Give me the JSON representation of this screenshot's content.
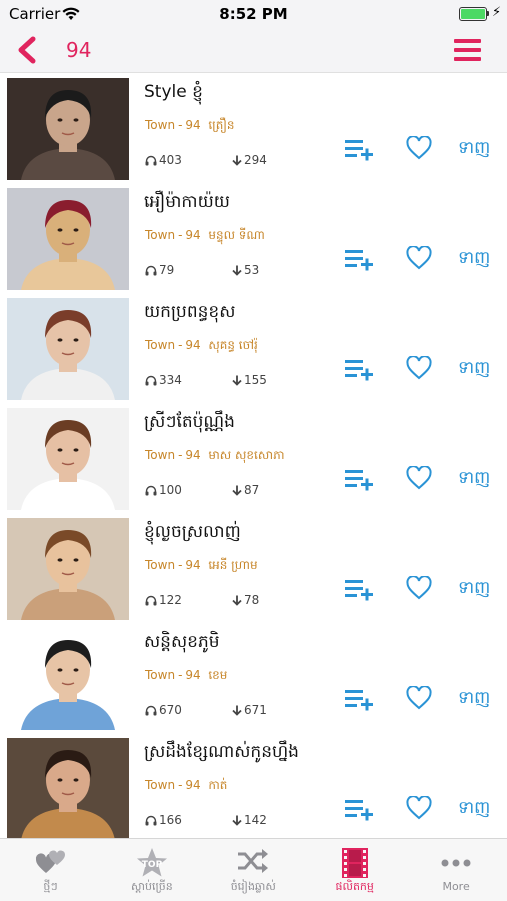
{
  "status_bar": {
    "carrier": "Carrier",
    "time": "8:52 PM",
    "battery_level": 1.0
  },
  "nav": {
    "title": "94",
    "back_icon": "chevron-left-icon",
    "menu_icon": "hamburger-menu-icon",
    "accent": "#e0245e"
  },
  "songs": [
    {
      "title": "Style ខ្ញុំ",
      "album": "Town",
      "number": "94",
      "artist": "ត្រឿន",
      "listens": "403",
      "downloads": "294",
      "get_label": "ទាញ"
    },
    {
      "title": "អឿម៉ាកាយ៉យ",
      "album": "Town",
      "number": "94",
      "artist": "មន្ទុល ទីណា",
      "listens": "79",
      "downloads": "53",
      "get_label": "ទាញ"
    },
    {
      "title": "យកប្រពន្ធខុស",
      "album": "Town",
      "number": "94",
      "artist": "សុគន្ធ ចៅរ៉ុ",
      "listens": "334",
      "downloads": "155",
      "get_label": "ទាញ"
    },
    {
      "title": "ស្រីៗតែប៉ុណ្ណឹង",
      "album": "Town",
      "number": "94",
      "artist": "មាស សុខសោភា",
      "listens": "100",
      "downloads": "87",
      "get_label": "ទាញ"
    },
    {
      "title": "ខ្ញុំល្ងចស្រលាញ់",
      "album": "Town",
      "number": "94",
      "artist": "អេនី ហ្រាម",
      "listens": "122",
      "downloads": "78",
      "get_label": "ទាញ"
    },
    {
      "title": "សន្តិសុខភូមិ",
      "album": "Town",
      "number": "94",
      "artist": "ខេម",
      "listens": "670",
      "downloads": "671",
      "get_label": "ទាញ"
    },
    {
      "title": "ស្រដឹងខ្សែណាស់កូនហ្នឹង",
      "album": "Town",
      "number": "94",
      "artist": "កាត់",
      "listens": "166",
      "downloads": "142",
      "get_label": "ទាញ"
    }
  ],
  "tabs": [
    {
      "label": "ថ្មីៗ",
      "icon": "hearts-icon",
      "active": false
    },
    {
      "label": "ស្តាប់ច្រើន",
      "icon": "top-star-icon",
      "active": false
    },
    {
      "label": "ចំរៀងឆ្លាស់",
      "icon": "shuffle-icon",
      "active": false
    },
    {
      "label": "ផលិតកម្ម",
      "icon": "film-strip-icon",
      "active": true
    },
    {
      "label": "More",
      "icon": "more-dots-icon",
      "active": false
    }
  ],
  "colors": {
    "accent": "#e0245e",
    "action_blue": "#2a93d5",
    "meta": "#c7862a"
  }
}
